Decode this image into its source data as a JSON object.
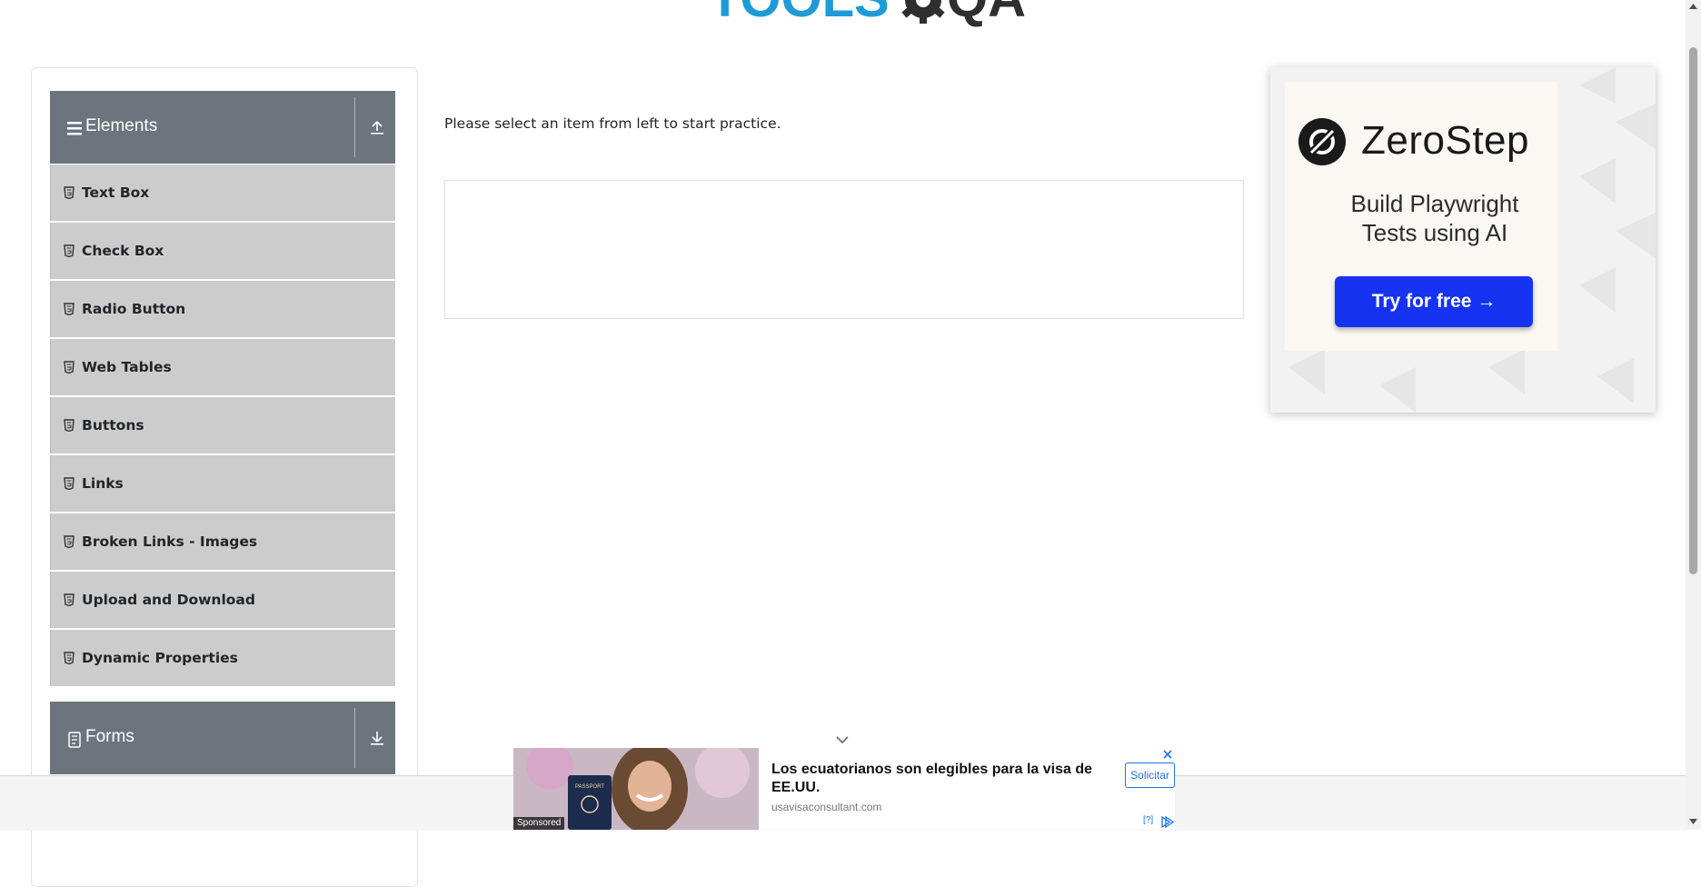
{
  "header": {
    "logo_text_left": "TOOLS",
    "logo_text_right": "QA"
  },
  "sidebar": {
    "groups": [
      {
        "title": "Elements",
        "expanded": true,
        "icon": "hamburger-icon",
        "toggle_icon": "collapse-up-icon",
        "items": [
          {
            "label": "Text Box"
          },
          {
            "label": "Check Box"
          },
          {
            "label": "Radio Button"
          },
          {
            "label": "Web Tables"
          },
          {
            "label": "Buttons"
          },
          {
            "label": "Links"
          },
          {
            "label": "Broken Links - Images"
          },
          {
            "label": "Upload and Download"
          },
          {
            "label": "Dynamic Properties"
          }
        ]
      },
      {
        "title": "Forms",
        "expanded": false,
        "icon": "form-icon",
        "toggle_icon": "expand-down-icon"
      }
    ],
    "item_icon": "html5-icon"
  },
  "main": {
    "instruction": "Please select an item from left to start practice."
  },
  "ad_right": {
    "brand": "ZeroStep",
    "headline_line1": "Build Playwright",
    "headline_line2": "Tests using AI",
    "cta": "Try for free →",
    "cta_color": "#1533f0"
  },
  "ad_bottom": {
    "sponsored": "Sponsored",
    "headline": "Los ecuatorianos son elegibles para la visa de EE.UU.",
    "domain": "usavisaconsultant.com",
    "cta": "Solicitar",
    "info": "[?]",
    "passport_text": "PASSPORT"
  },
  "colors": {
    "group_header": "#6c757d",
    "menu_item": "#cccccc",
    "logo_blue": "#1e9bd7",
    "logo_dark": "#2f2f2f"
  }
}
